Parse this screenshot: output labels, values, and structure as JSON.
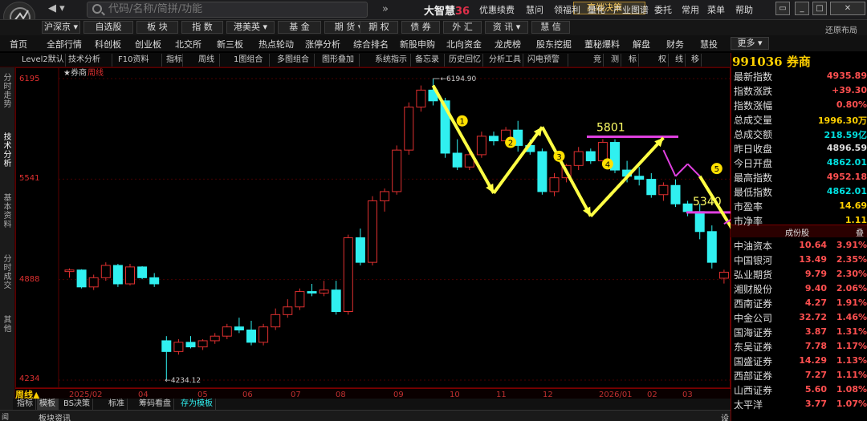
{
  "topbar": {
    "search_placeholder": "代码/名称/简拼/功能",
    "brand_main": "大智慧",
    "brand_num": "36",
    "links": [
      "优惠续费",
      "慧问",
      "领福利",
      "量化",
      "产业图谱",
      "委托",
      "常用",
      "菜单",
      "帮助"
    ]
  },
  "toolbar2": {
    "buttons": [
      "沪深京 ▾",
      "自选股",
      "板 块",
      "指 数",
      "港美英 ▾",
      "基 金",
      "期 货 ▾",
      "期 权",
      "债 券",
      "外 汇",
      "资 讯 ▾",
      "慧 信"
    ],
    "premium": "高端决策"
  },
  "toolbar3": {
    "items": [
      "首页",
      "全部行情",
      "科创板",
      "创业板",
      "北交所",
      "新三板",
      "热点轮动",
      "涨停分析",
      "综合排名",
      "新股申购",
      "北向资金",
      "龙虎榜",
      "股东挖掘",
      "董秘爆料",
      "解盘",
      "财务",
      "慧投"
    ],
    "more": "更多 ▾",
    "restore": "还原布局"
  },
  "toolbar4": {
    "items": [
      "Level2默认",
      "技术分析",
      "F10资料",
      "指标",
      "周线",
      "1图组合",
      "多图组合",
      "图形叠加",
      "系统指示",
      "备忘录",
      "历史回忆",
      "分析工具",
      "闪电预警",
      "竞",
      "测",
      "标",
      "权",
      "线",
      "移"
    ]
  },
  "leftstrip": {
    "tabs": [
      "分时走势",
      "技术分析",
      "基本资料",
      "分时成交",
      "其他"
    ]
  },
  "chart": {
    "legend_name": "券商",
    "legend_period": "周线",
    "period_label": "周线▲",
    "y_labels": [
      "6195",
      "5541",
      "4888",
      "4234"
    ],
    "x_labels": [
      "2025/02",
      "04",
      "05",
      "06",
      "07",
      "08",
      "09",
      "10",
      "11",
      "12",
      "2026/01",
      "02",
      "03"
    ],
    "high_note": "6194.90",
    "low_note": "4234.12",
    "level1": "5801",
    "level2": "5340",
    "marks": [
      "1",
      "2",
      "3",
      "4",
      "5"
    ]
  },
  "bottom_tabs": [
    "指标",
    "模板",
    "BS决策",
    "标准",
    "筹码看盘",
    "存为模板"
  ],
  "status": {
    "text": "板块资讯",
    "right": "设"
  },
  "quote": {
    "code": "991036",
    "name": "券商",
    "stats": [
      {
        "label": "最新指数",
        "value": "4935.89",
        "color": "#ff5050"
      },
      {
        "label": "指数涨跌",
        "value": "+39.30",
        "color": "#ff5050"
      },
      {
        "label": "指数涨幅",
        "value": "0.80%",
        "color": "#ff5050"
      },
      {
        "label": "总成交量",
        "value": "1996.30万",
        "color": "#ffd000"
      },
      {
        "label": "总成交额",
        "value": "218.59亿",
        "color": "#00e0e0"
      },
      {
        "label": "昨日收盘",
        "value": "4896.59",
        "color": "#dddddd"
      },
      {
        "label": "今日开盘",
        "value": "4862.01",
        "color": "#00e0e0"
      },
      {
        "label": "最高指数",
        "value": "4952.18",
        "color": "#ff5050"
      },
      {
        "label": "最低指数",
        "value": "4862.01",
        "color": "#00e0e0"
      },
      {
        "label": "市盈率",
        "value": "14.69",
        "color": "#ffd000"
      },
      {
        "label": "市净率",
        "value": "1.11",
        "color": "#ffd000"
      }
    ],
    "constituents_header": "成份股",
    "constituents_icon": "叠",
    "constituents": [
      {
        "name": "中油资本",
        "price": "10.64",
        "chg": "3.91%"
      },
      {
        "name": "中国银河",
        "price": "13.49",
        "chg": "2.35%"
      },
      {
        "name": "弘业期货",
        "price": "9.79",
        "chg": "2.30%"
      },
      {
        "name": "湘财股份",
        "price": "9.40",
        "chg": "2.06%"
      },
      {
        "name": "西南证券",
        "price": "4.27",
        "chg": "1.91%"
      },
      {
        "name": "中金公司",
        "price": "32.72",
        "chg": "1.46%"
      },
      {
        "name": "国海证券",
        "price": "3.87",
        "chg": "1.31%"
      },
      {
        "name": "东吴证券",
        "price": "7.78",
        "chg": "1.17%"
      },
      {
        "name": "国盛证券",
        "price": "14.29",
        "chg": "1.13%"
      },
      {
        "name": "西部证券",
        "price": "7.27",
        "chg": "1.11%"
      },
      {
        "name": "山西证券",
        "price": "5.60",
        "chg": "1.08%"
      },
      {
        "name": "太平洋",
        "price": "3.77",
        "chg": "1.07%"
      }
    ]
  },
  "colors": {
    "up": "#e03030",
    "down": "#30f0f0",
    "arrow": "#ffff44",
    "mag": "#e040e0"
  },
  "chart_data": {
    "type": "candlestick",
    "title": "券商",
    "period": "周线",
    "ylim": [
      4234.12,
      6194.9
    ],
    "y_ticks": [
      6195,
      5541,
      4888,
      4234
    ],
    "high": 6194.9,
    "low": 4234.12,
    "candles": [
      [
        4940,
        4960,
        4900,
        4950
      ],
      [
        4950,
        4955,
        4830,
        4840
      ],
      [
        4840,
        4920,
        4820,
        4900
      ],
      [
        4900,
        5000,
        4880,
        4980
      ],
      [
        4980,
        4990,
        4840,
        4860
      ],
      [
        4860,
        4990,
        4850,
        4970
      ],
      [
        4970,
        4975,
        4890,
        4900
      ],
      [
        4900,
        4930,
        4840,
        4860
      ],
      [
        4490,
        4520,
        4234.12,
        4420
      ],
      [
        4420,
        4500,
        4400,
        4480
      ],
      [
        4480,
        4520,
        4440,
        4450
      ],
      [
        4450,
        4500,
        4430,
        4490
      ],
      [
        4490,
        4540,
        4470,
        4520
      ],
      [
        4520,
        4600,
        4500,
        4580
      ],
      [
        4580,
        4640,
        4540,
        4560
      ],
      [
        4560,
        4620,
        4460,
        4480
      ],
      [
        4480,
        4600,
        4460,
        4580
      ],
      [
        4580,
        4700,
        4560,
        4660
      ],
      [
        4660,
        4760,
        4640,
        4710
      ],
      [
        4710,
        4830,
        4690,
        4810
      ],
      [
        4810,
        4860,
        4780,
        4800
      ],
      [
        4800,
        4880,
        4780,
        4820
      ],
      [
        4820,
        4880,
        4660,
        4680
      ],
      [
        4680,
        5180,
        4660,
        5160
      ],
      [
        5160,
        5220,
        4980,
        5000
      ],
      [
        5000,
        5430,
        4980,
        5400
      ],
      [
        5400,
        5480,
        5330,
        5460
      ],
      [
        5460,
        5760,
        5440,
        5730
      ],
      [
        5730,
        6040,
        5700,
        6010
      ],
      [
        6010,
        6150,
        5980,
        6120
      ],
      [
        6120,
        6194.9,
        6020,
        6050
      ],
      [
        6050,
        6070,
        5680,
        5710
      ],
      [
        5710,
        5800,
        5600,
        5620
      ],
      [
        5620,
        5720,
        5600,
        5700
      ],
      [
        5700,
        5850,
        5680,
        5820
      ],
      [
        5820,
        5850,
        5760,
        5790
      ],
      [
        5790,
        5880,
        5770,
        5860
      ],
      [
        5860,
        5920,
        5720,
        5760
      ],
      [
        5760,
        5800,
        5700,
        5720
      ],
      [
        5720,
        5740,
        5440,
        5460
      ],
      [
        5460,
        5580,
        5430,
        5550
      ],
      [
        5550,
        5640,
        5520,
        5630
      ],
      [
        5630,
        5750,
        5600,
        5720
      ],
      [
        5720,
        5740,
        5640,
        5660
      ],
      [
        5660,
        5801,
        5640,
        5780
      ],
      [
        5780,
        5800,
        5580,
        5600
      ],
      [
        5600,
        5660,
        5520,
        5560
      ],
      [
        5560,
        5620,
        5500,
        5540
      ],
      [
        5540,
        5580,
        5420,
        5440
      ],
      [
        5440,
        5520,
        5400,
        5500
      ],
      [
        5500,
        5540,
        5360,
        5380
      ],
      [
        5380,
        5400,
        5300,
        5330
      ],
      [
        5330,
        5380,
        5150,
        5200
      ],
      [
        5200,
        5240,
        4960,
        5000
      ],
      [
        4896.59,
        4952.18,
        4862.01,
        4935.89
      ]
    ]
  }
}
